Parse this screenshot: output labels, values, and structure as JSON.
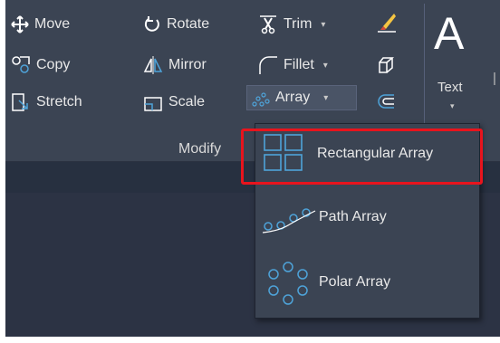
{
  "ribbon": {
    "modify_panel": {
      "title": "Modify",
      "tools": {
        "move": "Move",
        "rotate": "Rotate",
        "trim": "Trim",
        "copy": "Copy",
        "mirror": "Mirror",
        "fillet": "Fillet",
        "stretch": "Stretch",
        "scale": "Scale",
        "array": "Array"
      }
    },
    "annotation": {
      "text_icon": "A",
      "text_label": "Text"
    }
  },
  "array_dropdown": {
    "items": [
      {
        "label": "Rectangular Array",
        "icon": "rectangular-array-icon"
      },
      {
        "label": "Path Array",
        "icon": "path-array-icon"
      },
      {
        "label": "Polar Array",
        "icon": "polar-array-icon"
      }
    ]
  },
  "colors": {
    "ribbon_bg": "#3b4453",
    "canvas_bg": "#2c3344",
    "icon_accent": "#4ea3d9",
    "highlight": "#e8141d"
  }
}
